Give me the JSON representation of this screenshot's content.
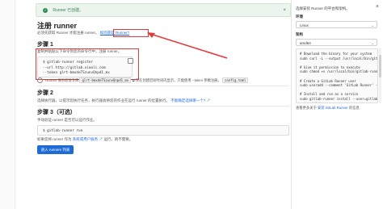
{
  "banner": {
    "text": "Runner 已创建。",
    "close": "×"
  },
  "page": {
    "title": "注册 runner",
    "subtitle_prefix": "必须先获取 Runner 才能注册 runner。",
    "subtitle_link": "如何获取 Runner?",
    "step1": {
      "title": "步骤 1",
      "desc": "复制并粘贴以下命令到您的命令行中，注册 runner。",
      "code": [
        "$ gitlab-runner register",
        "  --url http://gitlab.xiaoli.com",
        "  --token glrt-bmxdeTSzunvQnpd1_mx"
      ],
      "token_label": "Runner 身份验证令牌",
      "token_value": "glrt-bmxdeTSzunvQnpd1_mx",
      "token_note": "仅在创建后短时间内显示。只能使用 --token 参数注册。",
      "token_note_chip": "config.toml"
    },
    "step2": {
      "title": "步骤 2",
      "desc": "选择执行器，以提示您执行任务，执行器会将您的作业在运行 runner 的位置执行。",
      "link": "不能确定选择哪一个?"
    },
    "step3": {
      "title": "步骤 3（可选）",
      "desc": "手动验证 runner 是否可以运行作业。",
      "code": "$ gitlab-runner run",
      "note_prefix": "如果您将 runner 作为",
      "note_link": "系统或用户服务",
      "note_suffix": "运行，则不需要。"
    },
    "button": "进入 runners 列表"
  },
  "sidebar": {
    "header": "选择安装 Runner 的平台和架构。",
    "close": "×",
    "env_label": "环境",
    "env_value": "Linux",
    "arch_label": "架构",
    "arch_value": "amd64",
    "code": "# Download the binary for your system\nsudo curl -L --output /usr/local/bin/gitlab-runner\n\n# Give it permission to execute\nsudo chmod +x /usr/local/bin/gitlab-runner\n\n# Create a GitLab Runner user\nsudo useradd --comment 'GitLab Runner' --create-home\n\n# Install and run as a service\nsudo gitlab-runner install --user=gitlab-runner\nsudo gitlab-runner start",
    "footer_prefix": "查看更多关于",
    "footer_link": "安装 GitLab Runner",
    "footer_suffix": "的信息"
  },
  "colors": {
    "accent": "#1f6bd6",
    "highlight": "#e23b3b",
    "success": "#2e8b57"
  }
}
